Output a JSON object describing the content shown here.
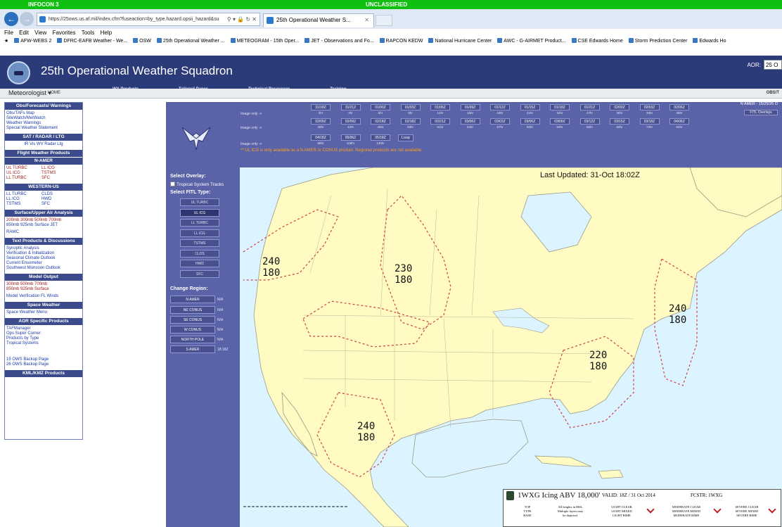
{
  "classification": {
    "infocon": "INFOCON 3",
    "label": "UNCLASSIFIED"
  },
  "browser": {
    "url": "https://25ows.us.af.mil/index.cfm?fuseaction=by_type.hazard.opsii_hazard&su",
    "tab_title": "25th Operational Weather S...",
    "menu": [
      "File",
      "Edit",
      "View",
      "Favorites",
      "Tools",
      "Help"
    ],
    "favorites": [
      "AFW-WEBS 2",
      "DFRC-EAFB Weather - We...",
      "OSW",
      "25th Operational Weather ...",
      "METEOGRAM - 15th Oper...",
      "JET - Observations and Fo...",
      "RAPCON KEDW",
      "National Hurricane Center",
      "AWC - G-AIRMET Product...",
      "CSE Edwards Home",
      "Storm Prediction Center",
      "Edwards Ho"
    ]
  },
  "header": {
    "title": "25th Operational Weather Squadron",
    "nav": [
      "WX Products",
      "Tailored Pages",
      "Technical Resources",
      "Training"
    ],
    "aor_label": "AOR:",
    "aor_value": "25 O"
  },
  "subbar": {
    "role": "Meteorologist",
    "home": "HOME",
    "obs": "OBS/T"
  },
  "sidebar": {
    "obs_h": "Obs/Forecasts/ Warnings",
    "obs_items": [
      "Obs/TAFs Map",
      "SiteWatch/MetWatch",
      "Weather Warnings",
      "Special Weather Statement"
    ],
    "sat_h": "SAT / RADAR / LTG",
    "sat_items": "IR   Vis   WV   Radar   Ltg",
    "fwp_h": "Flight Weather Products",
    "namer_h": "N-AMER",
    "namer_items": [
      "UL TURBC",
      "LL ICG",
      "UL ICG",
      "TSTMS",
      "LL TURBC",
      "SFC"
    ],
    "wus_h": "WESTERN-US",
    "wus_items": [
      "LL TURBC",
      "CLDS",
      "LL ICG",
      "HWD",
      "TSTMS",
      "SFC"
    ],
    "sua_h": "Surface/Upper Air Analysis",
    "sua_row1": "200mb  300mb  500mb   700mb",
    "sua_row2": "850mb  925mb  Surface  JET",
    "sua_row3": "RAWC",
    "tpd_h": "Text Products & Discussions",
    "tpd_items": [
      "Synoptic Analysis",
      "Verification & Initialization",
      "Seasonal Climate Outlook",
      "Current Ensometer",
      "Southwest Monsoon Outlook"
    ],
    "mo_h": "Model Output",
    "mo_row1": "300mb    500mb    700mb",
    "mo_row2": "850mb    925mb    Surface",
    "mo_row3": "Model Verification    FL Winds",
    "sw_h": "Space Weather",
    "sw_item": "Space Weather Menu",
    "aor_h": "AOR Specific Products",
    "aor_items": [
      "TAFManager",
      "Ops Super Corner",
      "Products by Type",
      "Tropical Systems"
    ],
    "backup_items": [
      "15 OWS Backup Page",
      "26 OWS Backup Page"
    ],
    "kml_h": "KML/KMZ Products"
  },
  "main": {
    "image_only": "Image only ->",
    "row1_times": [
      "31/18Z",
      "31/21Z",
      "01/00Z",
      "01/03Z",
      "01/06Z",
      "01/09Z",
      "01/12Z",
      "01/15Z",
      "01/18Z",
      "01/21Z",
      "02/00Z",
      "02/03Z",
      "02/06Z"
    ],
    "row1_hours": [
      "0hr",
      "3hr",
      "6hr",
      "9hr",
      "12hr",
      "15hr",
      "18hr",
      "21hr",
      "24hr",
      "27hr",
      "30hr",
      "33hr",
      "36hr"
    ],
    "row2_times": [
      "02/09Z",
      "02/09Z",
      "02/18Z",
      "02/18Z",
      "02/21Z",
      "03/06Z",
      "03/03Z",
      "03/06Z",
      "03/09Z",
      "03/12Z",
      "03/15Z",
      "03/18Z",
      "04/06Z"
    ],
    "row2_hours": [
      "39hr",
      "42hr",
      "45hr",
      "48hr",
      "51hr",
      "54hr",
      "57hr",
      "60hr",
      "63hr",
      "66hr",
      "69hr",
      "72hr",
      "84hr"
    ],
    "row3_times": [
      "04/18Z",
      "05/06Z",
      "05/18Z"
    ],
    "row3_hours": [
      "96hr",
      "108hr",
      "120hr"
    ],
    "loop": "Loop",
    "notice": "** UL ICG is only available as a N AMER or CONUS product. Regional products are not available.",
    "amer_label": "N AMER - 15/25/26 O",
    "fitl_overlays": "FITL Overlays",
    "select_overlay": "Select Overlay:",
    "tropical": "Tropical System Tracks",
    "select_fitl": "Select FITL Type:",
    "fitl_types": [
      "UL TURBC",
      "UL ICG",
      "LL TURBC",
      "LL ICG",
      "TSTMS",
      "CLDS",
      "HWD",
      "SFC"
    ],
    "change_region": "Change Region:",
    "regions": [
      "N AMER",
      "NE CONUS",
      "SE CONUS",
      "W CONUS",
      "NORTH POLE",
      "S AMER"
    ],
    "region_vals": [
      "N/A",
      "N/A",
      "N/A",
      "N/A",
      "N/A",
      "18:18Z"
    ]
  },
  "map": {
    "updated": "Last Updated: 31-Oct 18:02Z",
    "levels": [
      {
        "top": "240",
        "base": "180"
      },
      {
        "top": "230",
        "base": "180"
      },
      {
        "top": "240",
        "base": "180"
      },
      {
        "top": "220",
        "base": "180"
      },
      {
        "top": "240",
        "base": "180"
      }
    ]
  },
  "legend": {
    "title": "1WXG Icing ABV 18,000'",
    "valid": "VALID: 18Z / 31 Oct 2014",
    "fcstr": "FCSTR: 1WXG",
    "top_type_base": "TOP\nTYPE\nBASE",
    "note": "All heights in MSL\nMultiple layers may\nbe depicted.",
    "light": "LIGHT CLEAR\nLIGHT MIXED\nLIGHT RIME",
    "moderate": "MODERATE CLEAR\nMODERATE MIXED\nMODERATE RIME",
    "severe": "SEVERE CLEAR\nSEVERE MIXED\nSEVERE RIME"
  },
  "colors": {
    "header": "#2b3a78",
    "panel": "#5a63a8",
    "land": "#fffbc2",
    "ocean": "#dbf4ff",
    "classification": "#10c010",
    "icing": "#c44"
  }
}
